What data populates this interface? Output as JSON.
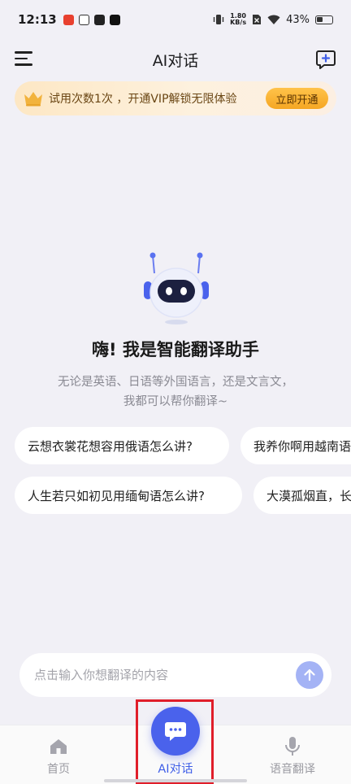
{
  "status_bar": {
    "time": "12:13",
    "net_speed_value": "1.80",
    "net_speed_unit": "KB/s",
    "battery": "43%",
    "battery_level": 0.43
  },
  "header": {
    "title": "AI对话",
    "menu_icon": "menu-icon",
    "new_chat_icon": "new-chat-icon"
  },
  "vip_banner": {
    "text": "试用次数1次 ，开通VIP解锁无限体验",
    "button_label": "立即开通"
  },
  "greeting": {
    "title": "嗨! 我是智能翻译助手",
    "line1": "无论是英语、日语等外国语言，还是文言文，",
    "line2": "我都可以帮你翻译~"
  },
  "suggestions": [
    {
      "text": "云想衣裳花想容用俄语怎么讲?"
    },
    {
      "text": "我养你啊用越南语怎么讲?"
    },
    {
      "text": "人生若只如初见用缅甸语怎么讲?"
    },
    {
      "text": "大漠孤烟直，长河落日圆"
    }
  ],
  "input": {
    "placeholder": "点击输入你想翻译的内容",
    "value": ""
  },
  "nav": {
    "items": [
      {
        "label": "首页",
        "icon": "home-icon"
      },
      {
        "label": "AI对话",
        "icon": "chat-bubble-icon"
      },
      {
        "label": "语音翻译",
        "icon": "microphone-icon"
      }
    ]
  },
  "colors": {
    "accent": "#4a62ec",
    "background": "#f1f0f6",
    "vip_button": "#f5a623",
    "highlight": "#e01e2a"
  }
}
